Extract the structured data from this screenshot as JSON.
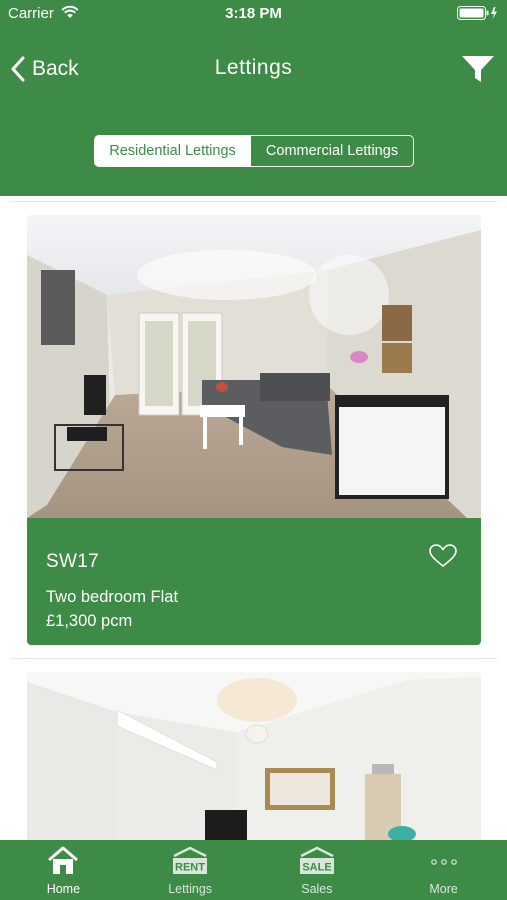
{
  "status_bar": {
    "carrier": "Carrier",
    "time": "3:18 PM"
  },
  "nav": {
    "back_label": "Back",
    "title": "Lettings"
  },
  "segments": {
    "active": "Residential Lettings",
    "inactive": "Commercial Lettings"
  },
  "listings": [
    {
      "postcode": "SW17",
      "type": "Two bedroom Flat",
      "price": "£1,300 pcm"
    },
    {
      "postcode": "",
      "type": "",
      "price": ""
    }
  ],
  "tabbar": {
    "home": "Home",
    "lettings": "Lettings",
    "lettings_icon_text": "RENT",
    "sales": "Sales",
    "sales_icon_text": "SALE",
    "more": "More"
  },
  "colors": {
    "brand": "#3d8b47",
    "text_on_brand": "#ffffff"
  }
}
